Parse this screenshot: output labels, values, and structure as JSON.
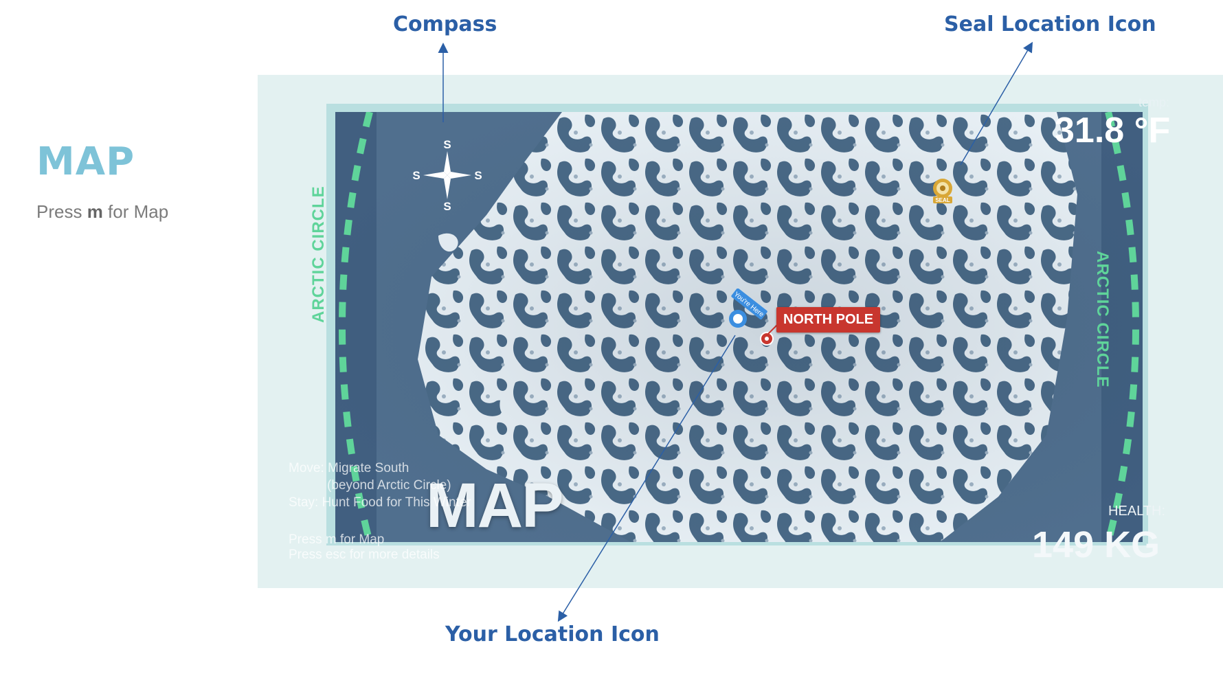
{
  "slide": {
    "title": "MAP",
    "subtitle_prefix": "Press ",
    "subtitle_key": "m",
    "subtitle_suffix": " for Map"
  },
  "callouts": {
    "compass": "Compass",
    "seal": "Seal Location Icon",
    "your_location": "Your Location Icon"
  },
  "game": {
    "temp_label": "temp:",
    "temp_value": "31.8 °F",
    "health_label": "HEALTH:",
    "health_value": "149 KG",
    "map_title": "MAP",
    "arctic_circle": "ARCTIC CIRCLE",
    "north_pole_label": "NORTH POLE",
    "you_are_here": "You're Here",
    "seal_tag": "SEAL",
    "compass_letters": [
      "S",
      "S",
      "S",
      "S"
    ],
    "controls": [
      "Move: Migrate South",
      "(beyond Arctic Circle)",
      "Stay:   Hunt Food for This Winter",
      "Press m for Map",
      "Press esc for more details"
    ]
  },
  "colors": {
    "callout": "#2b5fa6",
    "title": "#7ec3d8",
    "arctic_green": "#5fd49a",
    "ocean": "#4f7191",
    "north_pole_red": "#c8362e"
  }
}
